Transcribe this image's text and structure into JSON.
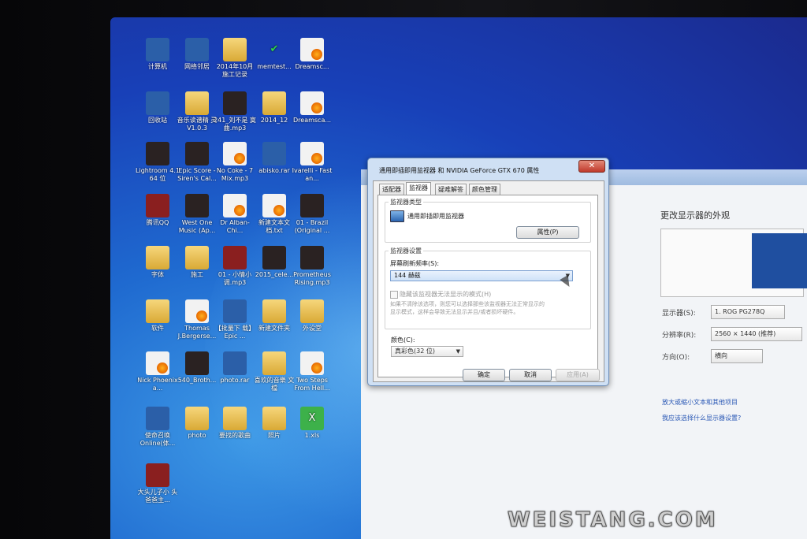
{
  "desktop": {
    "icons": [
      {
        "label": "计算机",
        "kind": "blue"
      },
      {
        "label": "网络邻居",
        "kind": "blue"
      },
      {
        "label": "2014年10月 施工记录",
        "kind": "folder"
      },
      {
        "label": "memtest...",
        "kind": "check"
      },
      {
        "label": "Dreamsc...",
        "kind": "media"
      },
      {
        "label": "回收站",
        "kind": "blue"
      },
      {
        "label": "音乐读谱精 灵V1.0.3",
        "kind": "folder"
      },
      {
        "label": "241_刘不是 寞曲.mp3",
        "kind": "dark"
      },
      {
        "label": "2014_12",
        "kind": "folder"
      },
      {
        "label": "Dreamsca...",
        "kind": "media"
      },
      {
        "label": "Lightroom 4.1 64 位",
        "kind": "dark"
      },
      {
        "label": "Epic Score - Siren's Cal...",
        "kind": "dark"
      },
      {
        "label": "No Coke - 7 Mix.mp3",
        "kind": "media"
      },
      {
        "label": "abisko.rar",
        "kind": "blue"
      },
      {
        "label": "Ivarelli - Fast an...",
        "kind": "media"
      },
      {
        "label": "腾讯QQ",
        "kind": "red"
      },
      {
        "label": "West One Music (Ap...",
        "kind": "dark"
      },
      {
        "label": "Dr Alban-Chi...",
        "kind": "media"
      },
      {
        "label": "新建文本文 档.txt",
        "kind": "media"
      },
      {
        "label": "01 - Brazil (Original ...",
        "kind": "dark"
      },
      {
        "label": "字体",
        "kind": "folder"
      },
      {
        "label": "施工",
        "kind": "folder"
      },
      {
        "label": "01 - 小情小 调.mp3",
        "kind": "red"
      },
      {
        "label": "2015_cele...",
        "kind": "dark"
      },
      {
        "label": "Prometheus Rising.mp3",
        "kind": "dark"
      },
      {
        "label": "软件",
        "kind": "folder"
      },
      {
        "label": "Thomas J.Bergerse...",
        "kind": "media"
      },
      {
        "label": "【批量下 载】Epic ...",
        "kind": "blue"
      },
      {
        "label": "新建文件夹",
        "kind": "folder"
      },
      {
        "label": "外设堂",
        "kind": "folder"
      },
      {
        "label": "Nick Phoenix a...",
        "kind": "media"
      },
      {
        "label": "540_Broth...",
        "kind": "dark"
      },
      {
        "label": "photo.rar",
        "kind": "blue"
      },
      {
        "label": "喜欢的音樂 文檔",
        "kind": "folder"
      },
      {
        "label": "Two Steps From Hell...",
        "kind": "media"
      },
      {
        "label": "使命召唤 Online(体...",
        "kind": "blue"
      },
      {
        "label": "photo",
        "kind": "folder"
      },
      {
        "label": "要找的歌曲",
        "kind": "folder"
      },
      {
        "label": "照片",
        "kind": "folder"
      },
      {
        "label": "1.xls",
        "kind": "green"
      },
      {
        "label": "大头儿子小 头爸爸主...",
        "kind": "red"
      }
    ]
  },
  "display_panel": {
    "title": "更改显示器的外观",
    "display_label": "显示器(S):",
    "display_value": "1. ROG PG278Q",
    "resolution_label": "分辨率(R):",
    "resolution_value": "2560 × 1440 (推荐)",
    "orientation_label": "方向(O):",
    "orientation_value": "横向",
    "link1": "放大或缩小文本和其他项目",
    "link2": "我应该选择什么显示器设置?"
  },
  "dialog": {
    "title": "通用即插即用监视器 和 NVIDIA GeForce GTX 670 属性",
    "close": "✕",
    "tabs": [
      "适配器",
      "监视器",
      "疑难解答",
      "颜色管理"
    ],
    "active_tab": "监视器",
    "monitor_type_caption": "监视器类型",
    "monitor_name": "通用即插即用监视器",
    "properties_button": "属性(P)",
    "monitor_settings_caption": "监视器设置",
    "refresh_rate_label": "屏幕刷新频率(S):",
    "refresh_rate_value": "144 赫兹",
    "hide_modes_label": "隐藏该监视器无法显示的模式(H)",
    "hide_modes_note_1": "如果不清除该选项，则您可以选择那些该监视器无法正常显示的",
    "hide_modes_note_2": "显示模式，这样会导致无法显示并且/或者损坏硬件。",
    "colors_label": "颜色(C):",
    "colors_value": "真彩色(32 位)",
    "ok_button": "确定",
    "cancel_button": "取消",
    "apply_button": "应用(A)"
  },
  "watermark": "WEISTANG.COM"
}
